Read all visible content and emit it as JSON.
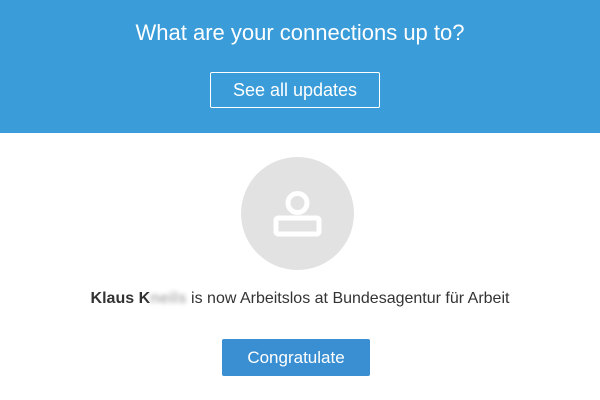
{
  "banner": {
    "title": "What are your connections up to?",
    "button_label": "See all updates"
  },
  "update": {
    "avatar_icon": "person-icon",
    "name_visible": "Klaus K",
    "name_obscured": "neils",
    "message": " is now Arbeitslos at Bundesagentur für Arbeit",
    "button_label": "Congratulate"
  },
  "colors": {
    "banner_bg": "#3a9cd9",
    "button_bg": "#3a8fd2",
    "avatar_bg": "#e2e2e2"
  }
}
